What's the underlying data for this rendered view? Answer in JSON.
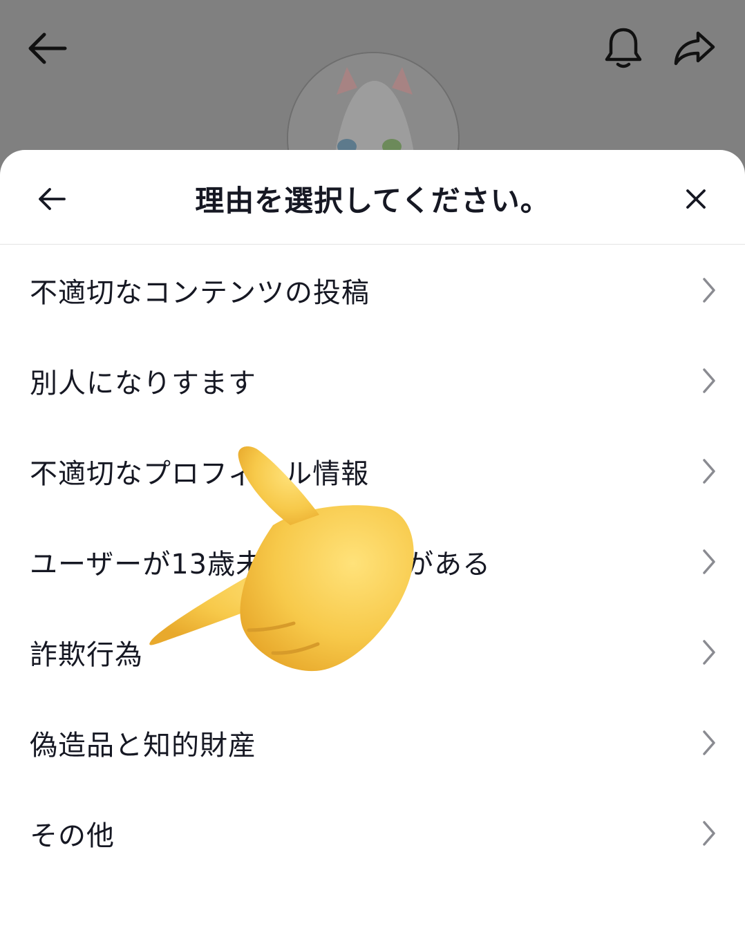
{
  "sheet": {
    "title": "理由を選択してください。"
  },
  "reasons": [
    {
      "label": "不適切なコンテンツの投稿"
    },
    {
      "label": "別人になりすます"
    },
    {
      "label": "不適切なプロフィール情報"
    },
    {
      "label": "ユーザーが13歳未満の可能性がある"
    },
    {
      "label": "詐欺行為"
    },
    {
      "label": "偽造品と知的財産"
    },
    {
      "label": "その他"
    }
  ],
  "icons": {
    "top_back": "back-arrow-icon",
    "bell": "bell-icon",
    "share": "share-icon",
    "sheet_back": "back-arrow-icon",
    "sheet_close": "close-icon",
    "row": "chevron-right-icon",
    "overlay": "pointing-hand-emoji"
  },
  "colors": {
    "backdrop": "#808080",
    "sheet": "#ffffff",
    "text": "#161823",
    "chevron": "#8a8b91",
    "hand": "#f7c94a"
  }
}
